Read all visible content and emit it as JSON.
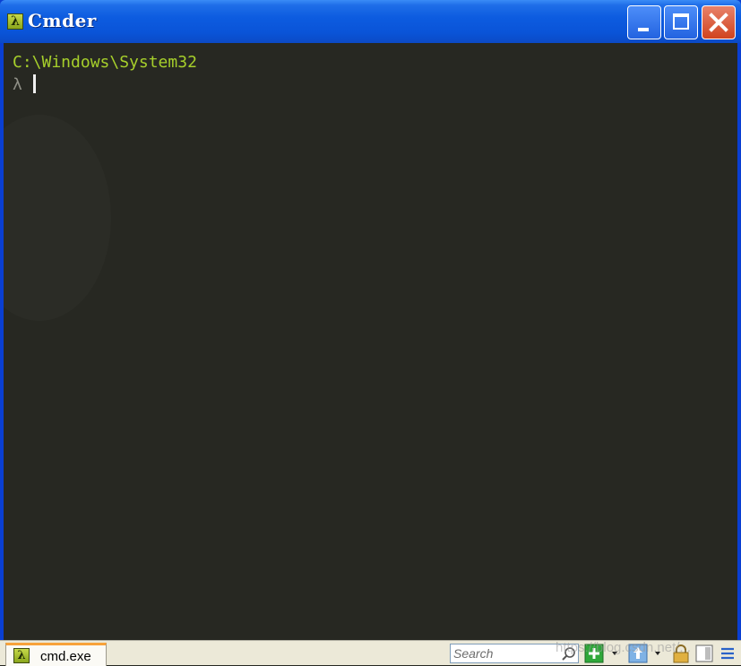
{
  "window": {
    "title": "Cmder",
    "app_icon_glyph": "λ",
    "controls": {
      "minimize": "minimize-icon",
      "maximize": "maximize-icon",
      "close": "close-icon"
    }
  },
  "terminal": {
    "path": "C:\\Windows\\System32",
    "prompt": "λ",
    "colors": {
      "background": "#272822",
      "path": "#a6cf2b",
      "prompt": "#8f8f86"
    }
  },
  "statusbar": {
    "tab": {
      "label": "cmd.exe",
      "icon_glyph": "λ",
      "accent": "#f7a23a"
    },
    "search": {
      "placeholder": "Search"
    },
    "toolbar_icons": [
      "new-console-icon",
      "dropdown-icon",
      "upload-icon",
      "dropdown-icon",
      "lock-icon",
      "panes-icon",
      "menu-icon"
    ]
  },
  "colors": {
    "titlebar": "#0a54d8",
    "close_button": "#d0431f"
  },
  "watermark": "https://blog.csdn.net/..."
}
